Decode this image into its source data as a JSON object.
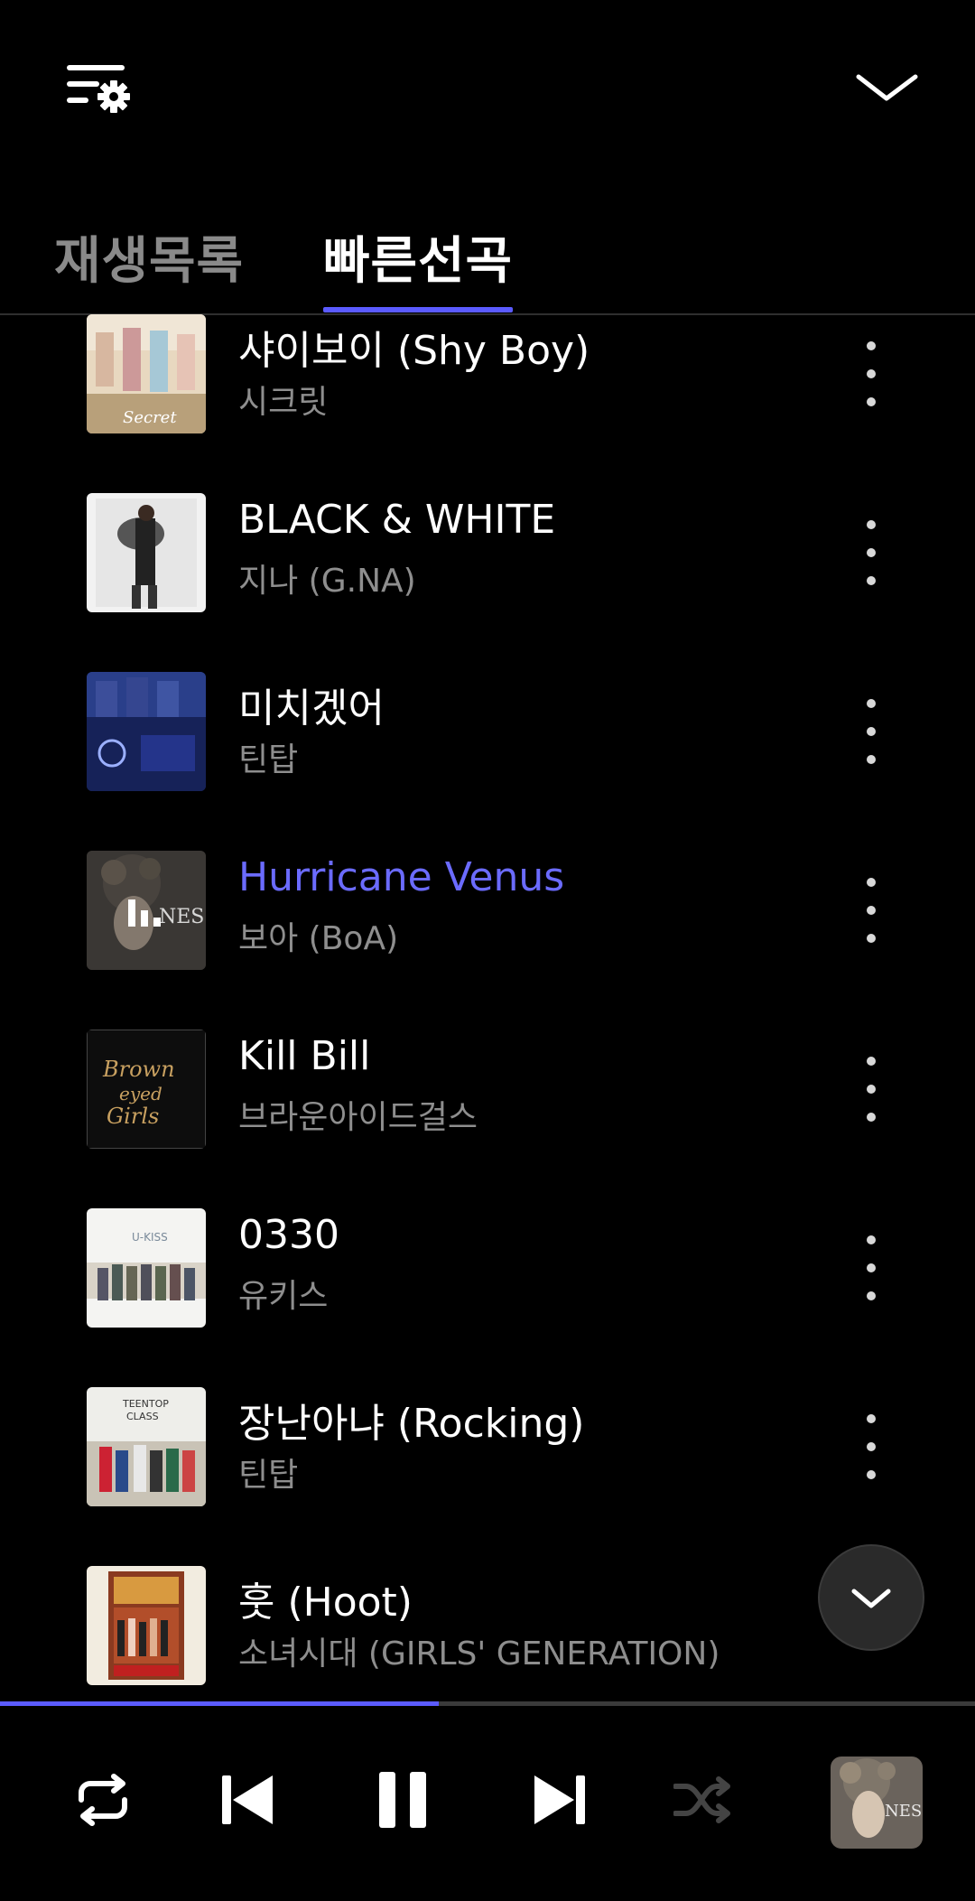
{
  "header": {
    "settings_icon": "queue-settings-icon",
    "collapse_icon": "chevron-down-icon"
  },
  "tabs": {
    "items": [
      {
        "label": "재생목록",
        "active": false
      },
      {
        "label": "빠른선곡",
        "active": true
      }
    ]
  },
  "tracks": [
    {
      "title": "샤이보이 (Shy Boy)",
      "artist": "시크릿",
      "playing": false
    },
    {
      "title": "BLACK & WHITE",
      "artist": "지나 (G.NA)",
      "playing": false
    },
    {
      "title": "미치겠어",
      "artist": "틴탑",
      "playing": false
    },
    {
      "title": "Hurricane Venus",
      "artist": "보아 (BoA)",
      "playing": true
    },
    {
      "title": "Kill Bill",
      "artist": "브라운아이드걸스",
      "playing": false
    },
    {
      "title": "0330",
      "artist": "유키스",
      "playing": false
    },
    {
      "title": "장난아냐 (Rocking)",
      "artist": "틴탑",
      "playing": false
    },
    {
      "title": "훗 (Hoot)",
      "artist": "소녀시대 (GIRLS' GENERATION)",
      "playing": false
    }
  ],
  "player": {
    "progress_fraction": 0.45,
    "icons": [
      "repeat-icon",
      "previous-icon",
      "pause-icon",
      "next-icon",
      "shuffle-icon"
    ]
  },
  "colors": {
    "accent": "#5b5bff",
    "playing_text": "#6b6bff",
    "background": "#000000",
    "secondary_text": "#8e8e8e"
  }
}
